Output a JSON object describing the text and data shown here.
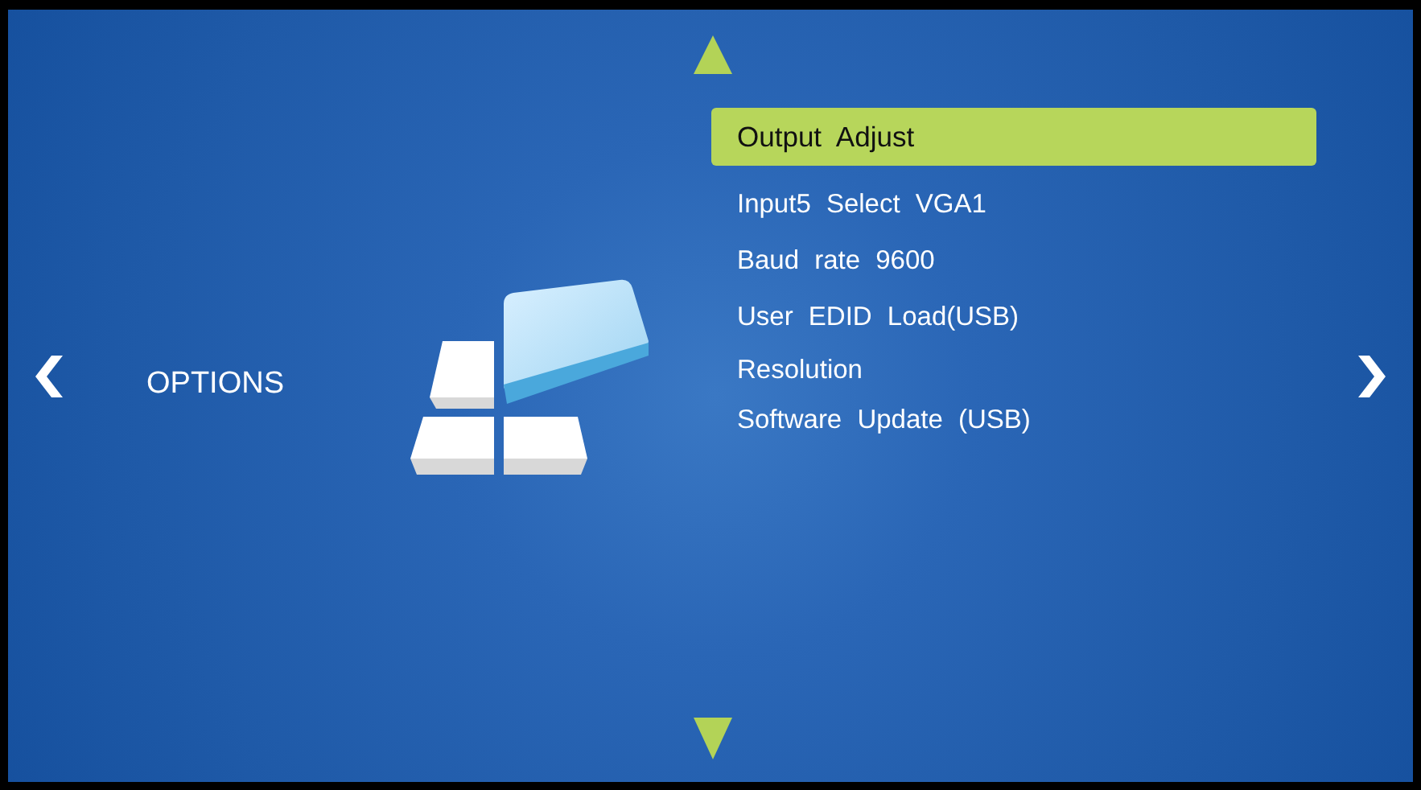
{
  "title": "OPTIONS",
  "menu": [
    {
      "label": "Output Adjust",
      "selected": true
    },
    {
      "label": "Input5 Select VGA1",
      "selected": false
    },
    {
      "label": "Baud rate 9600",
      "selected": false
    },
    {
      "label": "User EDID Load(USB)",
      "selected": false
    },
    {
      "label": "Resolution",
      "selected": false
    },
    {
      "label": "Software Update (USB)",
      "selected": false
    }
  ]
}
